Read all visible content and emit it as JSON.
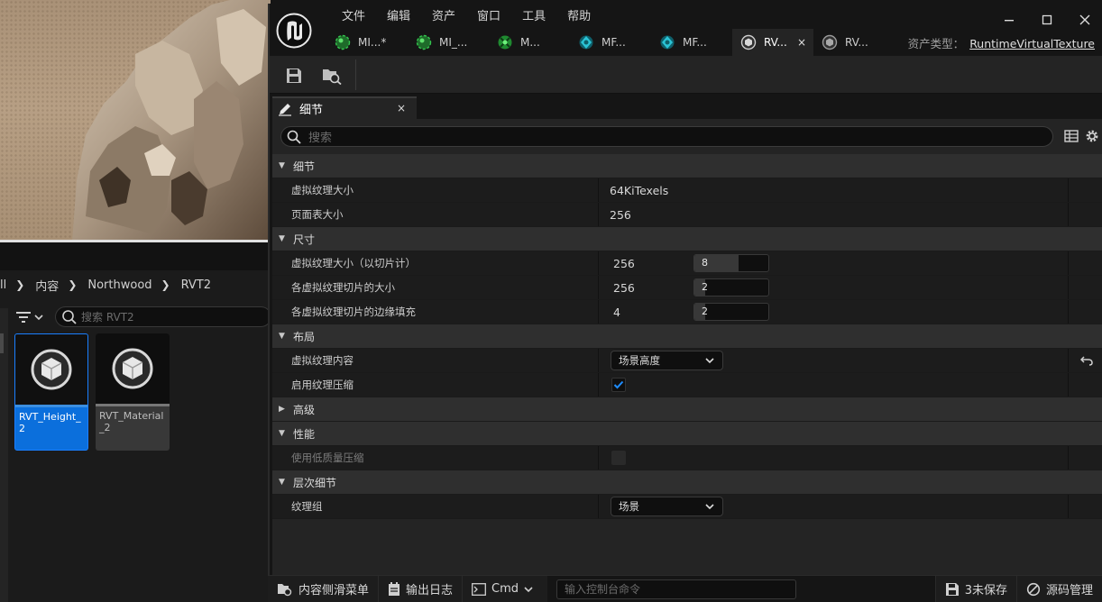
{
  "content_browser": {
    "path": [
      "ll",
      "内容",
      "Northwood",
      "RVT2"
    ],
    "search_placeholder": "搜索 RVT2",
    "assets": [
      {
        "name": "RVT_Height_2",
        "selected": true
      },
      {
        "name": "RVT_Material_2",
        "selected": false
      }
    ]
  },
  "menu": [
    "文件",
    "编辑",
    "资产",
    "窗口",
    "工具",
    "帮助"
  ],
  "tabs": [
    {
      "label": "MI...*",
      "icon": "material-instance-icon",
      "active": false
    },
    {
      "label": "MI_...",
      "icon": "material-instance-icon",
      "active": false
    },
    {
      "label": "M...",
      "icon": "material-icon",
      "active": false
    },
    {
      "label": "MF...",
      "icon": "material-function-icon",
      "active": false
    },
    {
      "label": "MF...",
      "icon": "material-function-icon",
      "active": false
    },
    {
      "label": "RV...",
      "icon": "runtime-virtual-texture-icon",
      "active": true,
      "close": "×"
    },
    {
      "label": "RV...",
      "icon": "runtime-virtual-texture-icon",
      "active": false
    }
  ],
  "asset_type": {
    "label": "资产类型：",
    "value": "RuntimeVirtualTexture"
  },
  "details_tab": {
    "label": "细节",
    "close": "×"
  },
  "details_search_placeholder": "搜索",
  "categories": {
    "detail": {
      "label": "细节",
      "rows": {
        "vt_size": {
          "label": "虚拟纹理大小",
          "value": "64KiTexels"
        },
        "page_table_size": {
          "label": "页面表大小",
          "value": "256"
        }
      }
    },
    "size": {
      "label": "尺寸",
      "rows": {
        "tile_count": {
          "label": "虚拟纹理大小（以切片计）",
          "value": "256",
          "slider": "8",
          "fill": 0.6
        },
        "tile_size": {
          "label": "各虚拟纹理切片的大小",
          "value": "256",
          "slider": "2",
          "fill": 0.15
        },
        "tile_border": {
          "label": "各虚拟纹理切片的边缘填充",
          "value": "4",
          "slider": "2",
          "fill": 0.15
        }
      }
    },
    "layout": {
      "label": "布局",
      "rows": {
        "content": {
          "label": "虚拟纹理内容",
          "value": "场景高度"
        },
        "compress": {
          "label": "启用纹理压缩",
          "checked": true
        }
      }
    },
    "advanced": {
      "label": "高级"
    },
    "performance": {
      "label": "性能",
      "rows": {
        "low_quality": {
          "label": "使用低质量压缩",
          "checked": false
        }
      }
    },
    "lod": {
      "label": "层次细节",
      "rows": {
        "texture_group": {
          "label": "纹理组",
          "value": "场景"
        }
      }
    }
  },
  "statusbar": {
    "content_drawer": "内容侧滑菜单",
    "output_log": "输出日志",
    "cmd": "Cmd",
    "console_placeholder": "输入控制台命令",
    "unsaved": "3未保存",
    "source_control": "源码管理"
  },
  "colors": {
    "accent": "#0b6fdc",
    "panel": "#242424",
    "category": "#2f2f2f",
    "row": "#1c1c1c"
  }
}
